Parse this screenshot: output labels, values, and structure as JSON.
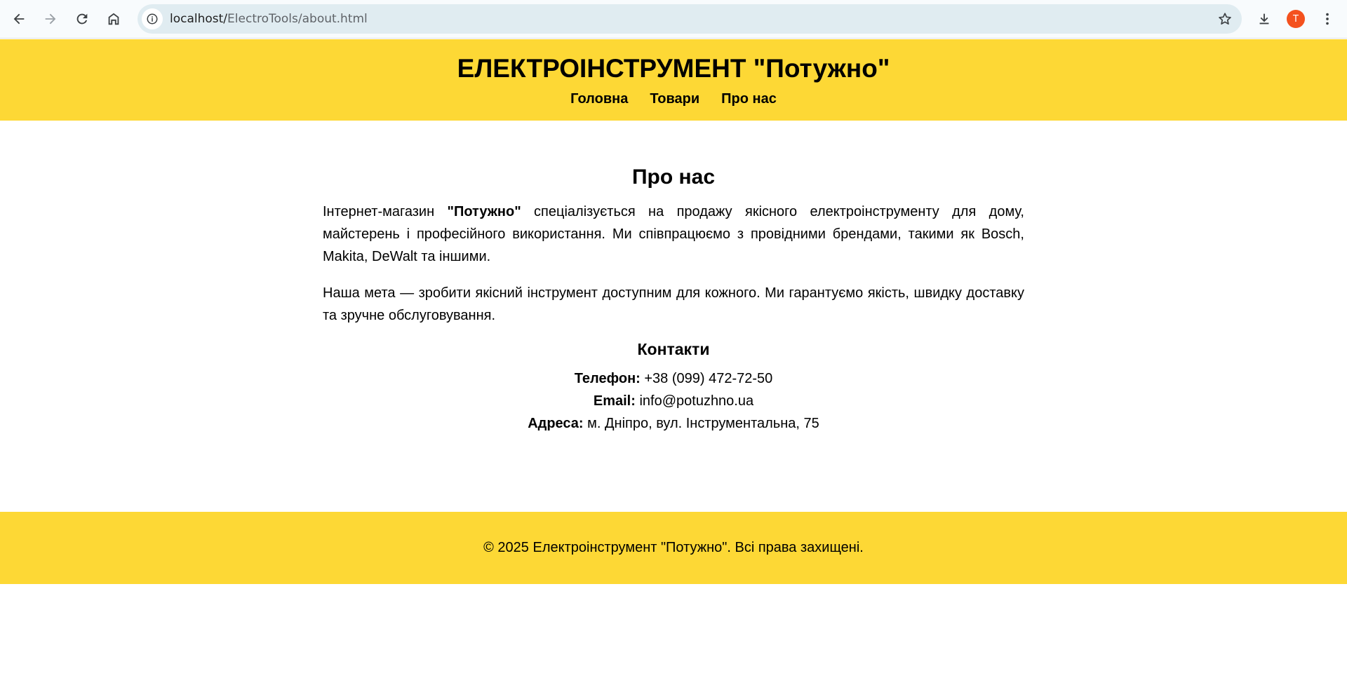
{
  "browser": {
    "url_host": "localhost/",
    "url_path": "ElectroTools/about.html",
    "avatar_letter": "T",
    "avatar_color": "#f4511e",
    "icons": [
      "back-icon",
      "forward-icon",
      "reload-icon",
      "home-icon",
      "site-info-icon",
      "bookmark-star-icon",
      "download-icon",
      "menu-dots-icon"
    ]
  },
  "header": {
    "title": "ЕЛЕКТРОІНСТРУМЕНТ \"Потужно\"",
    "nav": [
      {
        "label": "Головна"
      },
      {
        "label": "Товари"
      },
      {
        "label": "Про нас"
      }
    ],
    "background": "#fdd835"
  },
  "main": {
    "heading": "Про нас",
    "p1_before": "Інтернет-магазин ",
    "p1_brand": "\"Потужно\"",
    "p1_after": " спеціалізується на продажу якісного електроінструменту для дому, майстерень і професійного використання. Ми співпрацюємо з провідними брендами, такими як Bosch, Makita, DeWalt та іншими.",
    "p2": "Наша мета — зробити якісний інструмент доступним для кожного. Ми гарантуємо якість, швидку доставку та зручне обслуговування.",
    "contacts_title": "Контакти",
    "contacts": {
      "phone_label": "Телефон:",
      "phone_value": " +38 (099) 472-72-50",
      "email_label": "Email:",
      "email_value": " info@potuzhno.ua",
      "address_label": "Адреса:",
      "address_value": " м. Дніпро, вул. Інструментальна, 75"
    }
  },
  "footer": {
    "text": "© 2025 Електроінструмент \"Потужно\". Всі права захищені."
  }
}
